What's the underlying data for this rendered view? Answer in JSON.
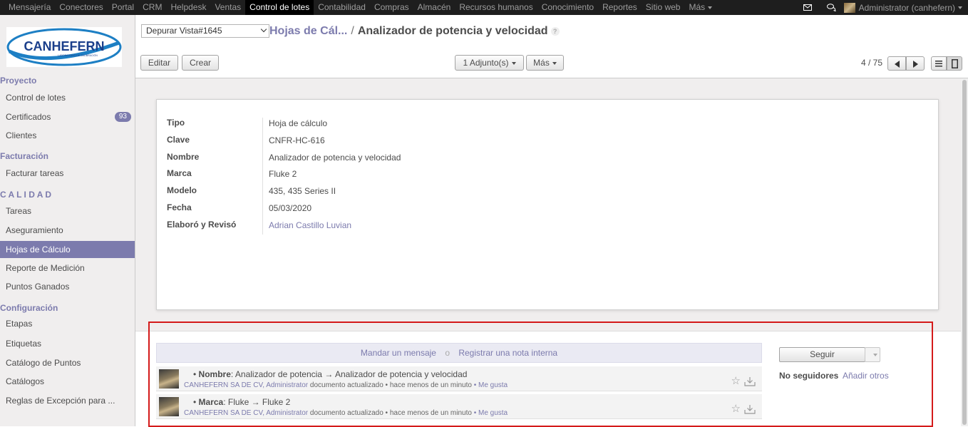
{
  "topbar": {
    "menus": [
      "Mensajería",
      "Conectores",
      "Portal",
      "CRM",
      "Helpdesk",
      "Ventas",
      "Control de lotes",
      "Contabilidad",
      "Compras",
      "Almacén",
      "Recursos humanos",
      "Conocimiento",
      "Reportes",
      "Sitio web",
      "Más"
    ],
    "active_menu": "Control de lotes",
    "user": "Administrator (canhefern)",
    "icons": [
      "envelope-icon",
      "chat-icon",
      "user-avatar"
    ]
  },
  "sidebar": {
    "logo_text": "CANHEFERN",
    "logo_subtext": "LABORATORIO DE CALIBRACIÓN",
    "sections": [
      {
        "header": "Proyecto",
        "items": [
          {
            "label": "Control de lotes"
          },
          {
            "label": "Certificados",
            "badge": "93"
          },
          {
            "label": "Clientes"
          }
        ]
      },
      {
        "header": "Facturación",
        "items": [
          {
            "label": "Facturar tareas"
          }
        ]
      },
      {
        "header": "C A L I D A D",
        "items": [
          {
            "label": "Tareas"
          },
          {
            "label": "Aseguramiento"
          },
          {
            "label": "Hojas de Cálculo"
          },
          {
            "label": "Reporte de Medición"
          },
          {
            "label": "Puntos Ganados"
          }
        ]
      },
      {
        "header": "Configuración",
        "items": [
          {
            "label": "Etapas"
          },
          {
            "label": "Etiquetas"
          },
          {
            "label": "Catálogo de Puntos"
          },
          {
            "label": "Catálogos"
          },
          {
            "label": "Reglas de Excepción para ..."
          }
        ]
      }
    ],
    "selected_item": "Hojas de Cálculo"
  },
  "control_panel": {
    "view_select": "Depurar Vista#1645",
    "breadcrumb": {
      "parent": "Hojas de Cál...",
      "separator": "/",
      "current": "Analizador de potencia y velocidad",
      "help": "?"
    },
    "buttons": {
      "edit": "Editar",
      "create": "Crear",
      "attachments": "1 Adjunto(s)",
      "more": "Más"
    },
    "pager": "4 / 75"
  },
  "form": {
    "fields": [
      {
        "label": "Tipo",
        "value": "Hoja de cálculo"
      },
      {
        "label": "Clave",
        "value": "CNFR-HC-616"
      },
      {
        "label": "Nombre",
        "value": "Analizador de potencia y velocidad"
      },
      {
        "label": "Marca",
        "value": "Fluke 2"
      },
      {
        "label": "Modelo",
        "value": "435, 435 Series II"
      },
      {
        "label": "Fecha",
        "value": "05/03/2020"
      },
      {
        "label": "Elaboró y Revisó",
        "value": "Adrian Castillo Luvian",
        "link": true
      }
    ]
  },
  "chatter": {
    "send_message": "Mandar un mensaje",
    "or": "o",
    "log_note": "Registrar una nota interna",
    "messages": [
      {
        "field": "Nombre",
        "change": ": Analizador de potencia → Analizador de potencia y velocidad",
        "author": "CANHEFERN SA DE CV, Administrator",
        "action": "documento actualizado",
        "time": "hace menos de un minuto",
        "like": "Me gusta"
      },
      {
        "field": "Marca",
        "change": ": Fluke → Fluke 2",
        "author": "CANHEFERN SA DE CV, Administrator",
        "action": "documento actualizado",
        "time": "hace menos de un minuto",
        "like": "Me gusta"
      }
    ],
    "follow_button": "Seguir",
    "no_followers": "No seguidores",
    "add_others": "Añadir otros"
  },
  "colors": {
    "brand": "#7c7bad",
    "topbar": "#1e1e1e",
    "highlight": "#d41a1a"
  }
}
